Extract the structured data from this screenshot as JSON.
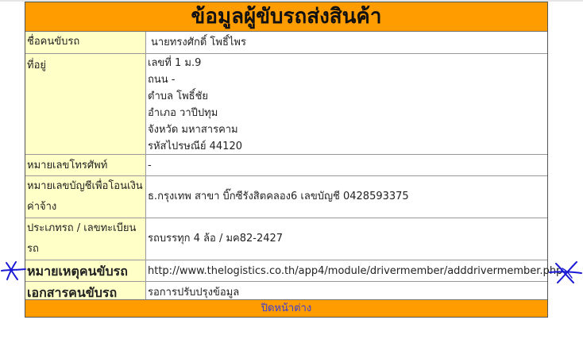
{
  "title": "ข้อมูลผู้ขับรถส่งสินค้า",
  "rows": {
    "name": {
      "label": "ชื่อคนขับรถ",
      "value": "นายทรงศักดิ์  โพธิ์ไพร"
    },
    "address": {
      "label": "ที่อยู่",
      "lines": [
        "เลขที่  1 ม.9",
        "ถนน -",
        "ตำบล โพธิ์ชัย",
        "อำเภอ วาปีปทุม",
        "จังหวัด มหาสารคาม",
        "รหัสไปรษณีย์ 44120"
      ]
    },
    "phone": {
      "label": "หมายเลขโทรศัพท์",
      "value": "-"
    },
    "bank": {
      "label_line1": "หมายเลขบัญชีเพื่อโอนเงิน",
      "label_line2": "ค่าจ้าง",
      "value": "ธ.กรุงเทพ สาขา บิ๊กซีรังสิตคลอง6  เลขบัญชี 0428593375"
    },
    "vehicle": {
      "label_line1": "ประเภทรถ / เลขทะเบียน",
      "label_line2": "รถ",
      "value": "รถบรรทุก 4 ล้อ / มค82-2427"
    },
    "note": {
      "label": "หมายเหตุคนขับรถ",
      "value": "http://www.thelogistics.co.th/app4/module/drivermember/adddrivermember.php"
    },
    "documents": {
      "label": "เอกสารคนขับรถ",
      "value": "รอการปรับปรุงข้อมูล"
    }
  },
  "close_label": "ปิดหน้าต่าง",
  "colors": {
    "header": "#ff9c00",
    "label_bg": "#ffffc8",
    "link": "#3b3bd6",
    "annotation": "#1a1ad6"
  }
}
